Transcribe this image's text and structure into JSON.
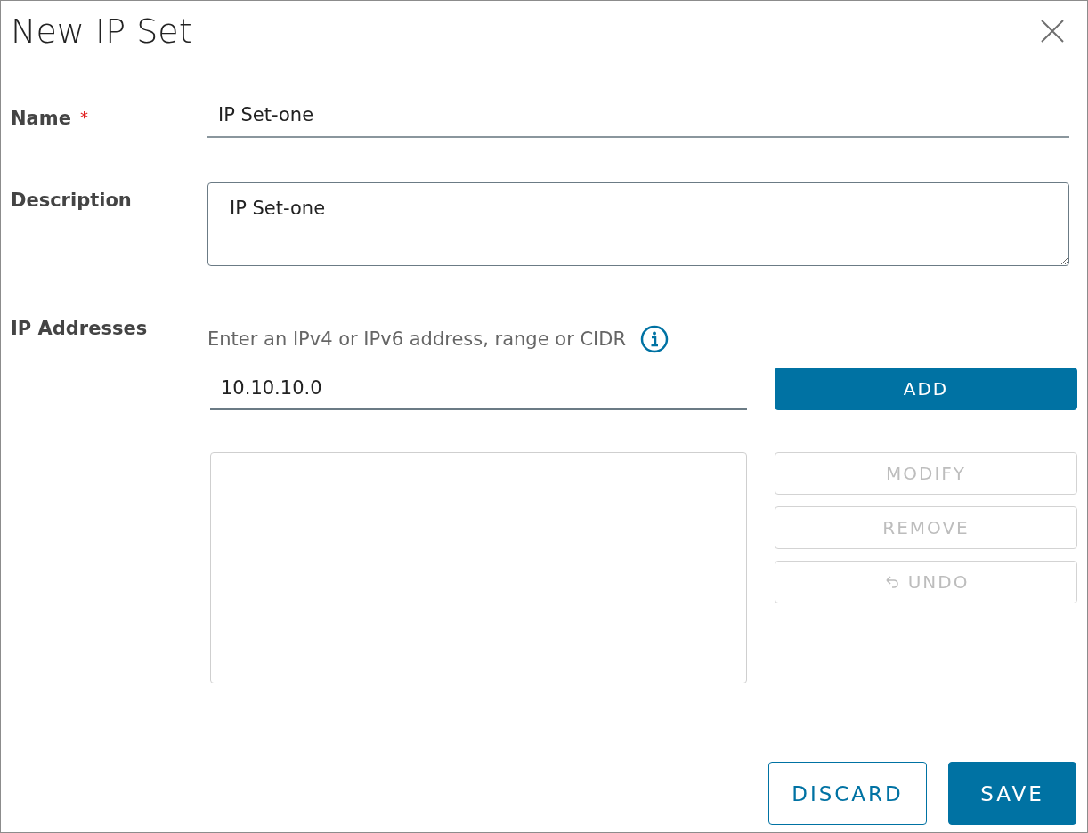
{
  "dialog": {
    "title": "New IP Set"
  },
  "name_field": {
    "label": "Name",
    "required_mark": "*",
    "value": "IP Set-one"
  },
  "description_field": {
    "label": "Description",
    "value": "IP Set-one"
  },
  "ip_addresses": {
    "label": "IP Addresses",
    "hint": "Enter an IPv4 or IPv6 address, range or CIDR",
    "input_value": "10.10.10.0",
    "add_button": {
      "label": "ADD",
      "disabled": false
    },
    "actions": [
      {
        "label": "MODIFY",
        "kind": "plain",
        "disabled": true
      },
      {
        "label": "REMOVE",
        "kind": "plain",
        "disabled": true
      },
      {
        "label": "UNDO",
        "kind": "undo",
        "disabled": true
      }
    ]
  },
  "footer_buttons": [
    {
      "label": "DISCARD",
      "kind": "outline"
    },
    {
      "label": "SAVE",
      "kind": "primary"
    }
  ]
}
